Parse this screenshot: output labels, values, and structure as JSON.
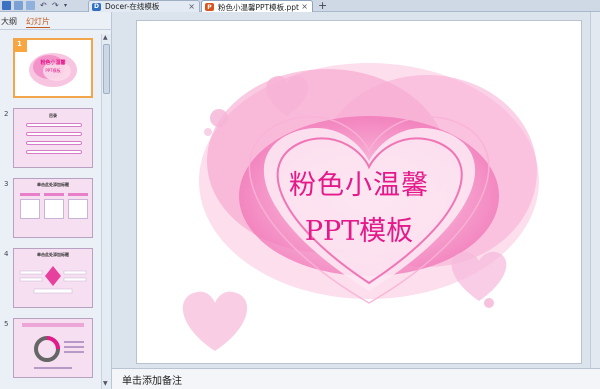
{
  "tabs": [
    {
      "label": "Docer-在线模板",
      "icon": "D"
    },
    {
      "label": "粉色小温馨PPT模板.ppt",
      "icon": "P"
    }
  ],
  "new_tab": "+",
  "close": "×",
  "panel_tabs": [
    "大纲",
    "幻灯片"
  ],
  "thumbnails": [
    {
      "number": "1",
      "title": "粉色小温馨",
      "subtitle": "PPT模板"
    },
    {
      "number": "2",
      "title": "目录"
    },
    {
      "number": "3",
      "title": "单击此处添加标题"
    },
    {
      "number": "4",
      "title": "单击此处添加标题"
    },
    {
      "number": "5"
    }
  ],
  "slide": {
    "title": "粉色小温馨",
    "subtitle": "PPT模板"
  },
  "notes_placeholder": "单击添加备注",
  "colors": {
    "accent": "#e4198a",
    "selection": "#f2a54a",
    "pink_light": "#f6dff0"
  }
}
